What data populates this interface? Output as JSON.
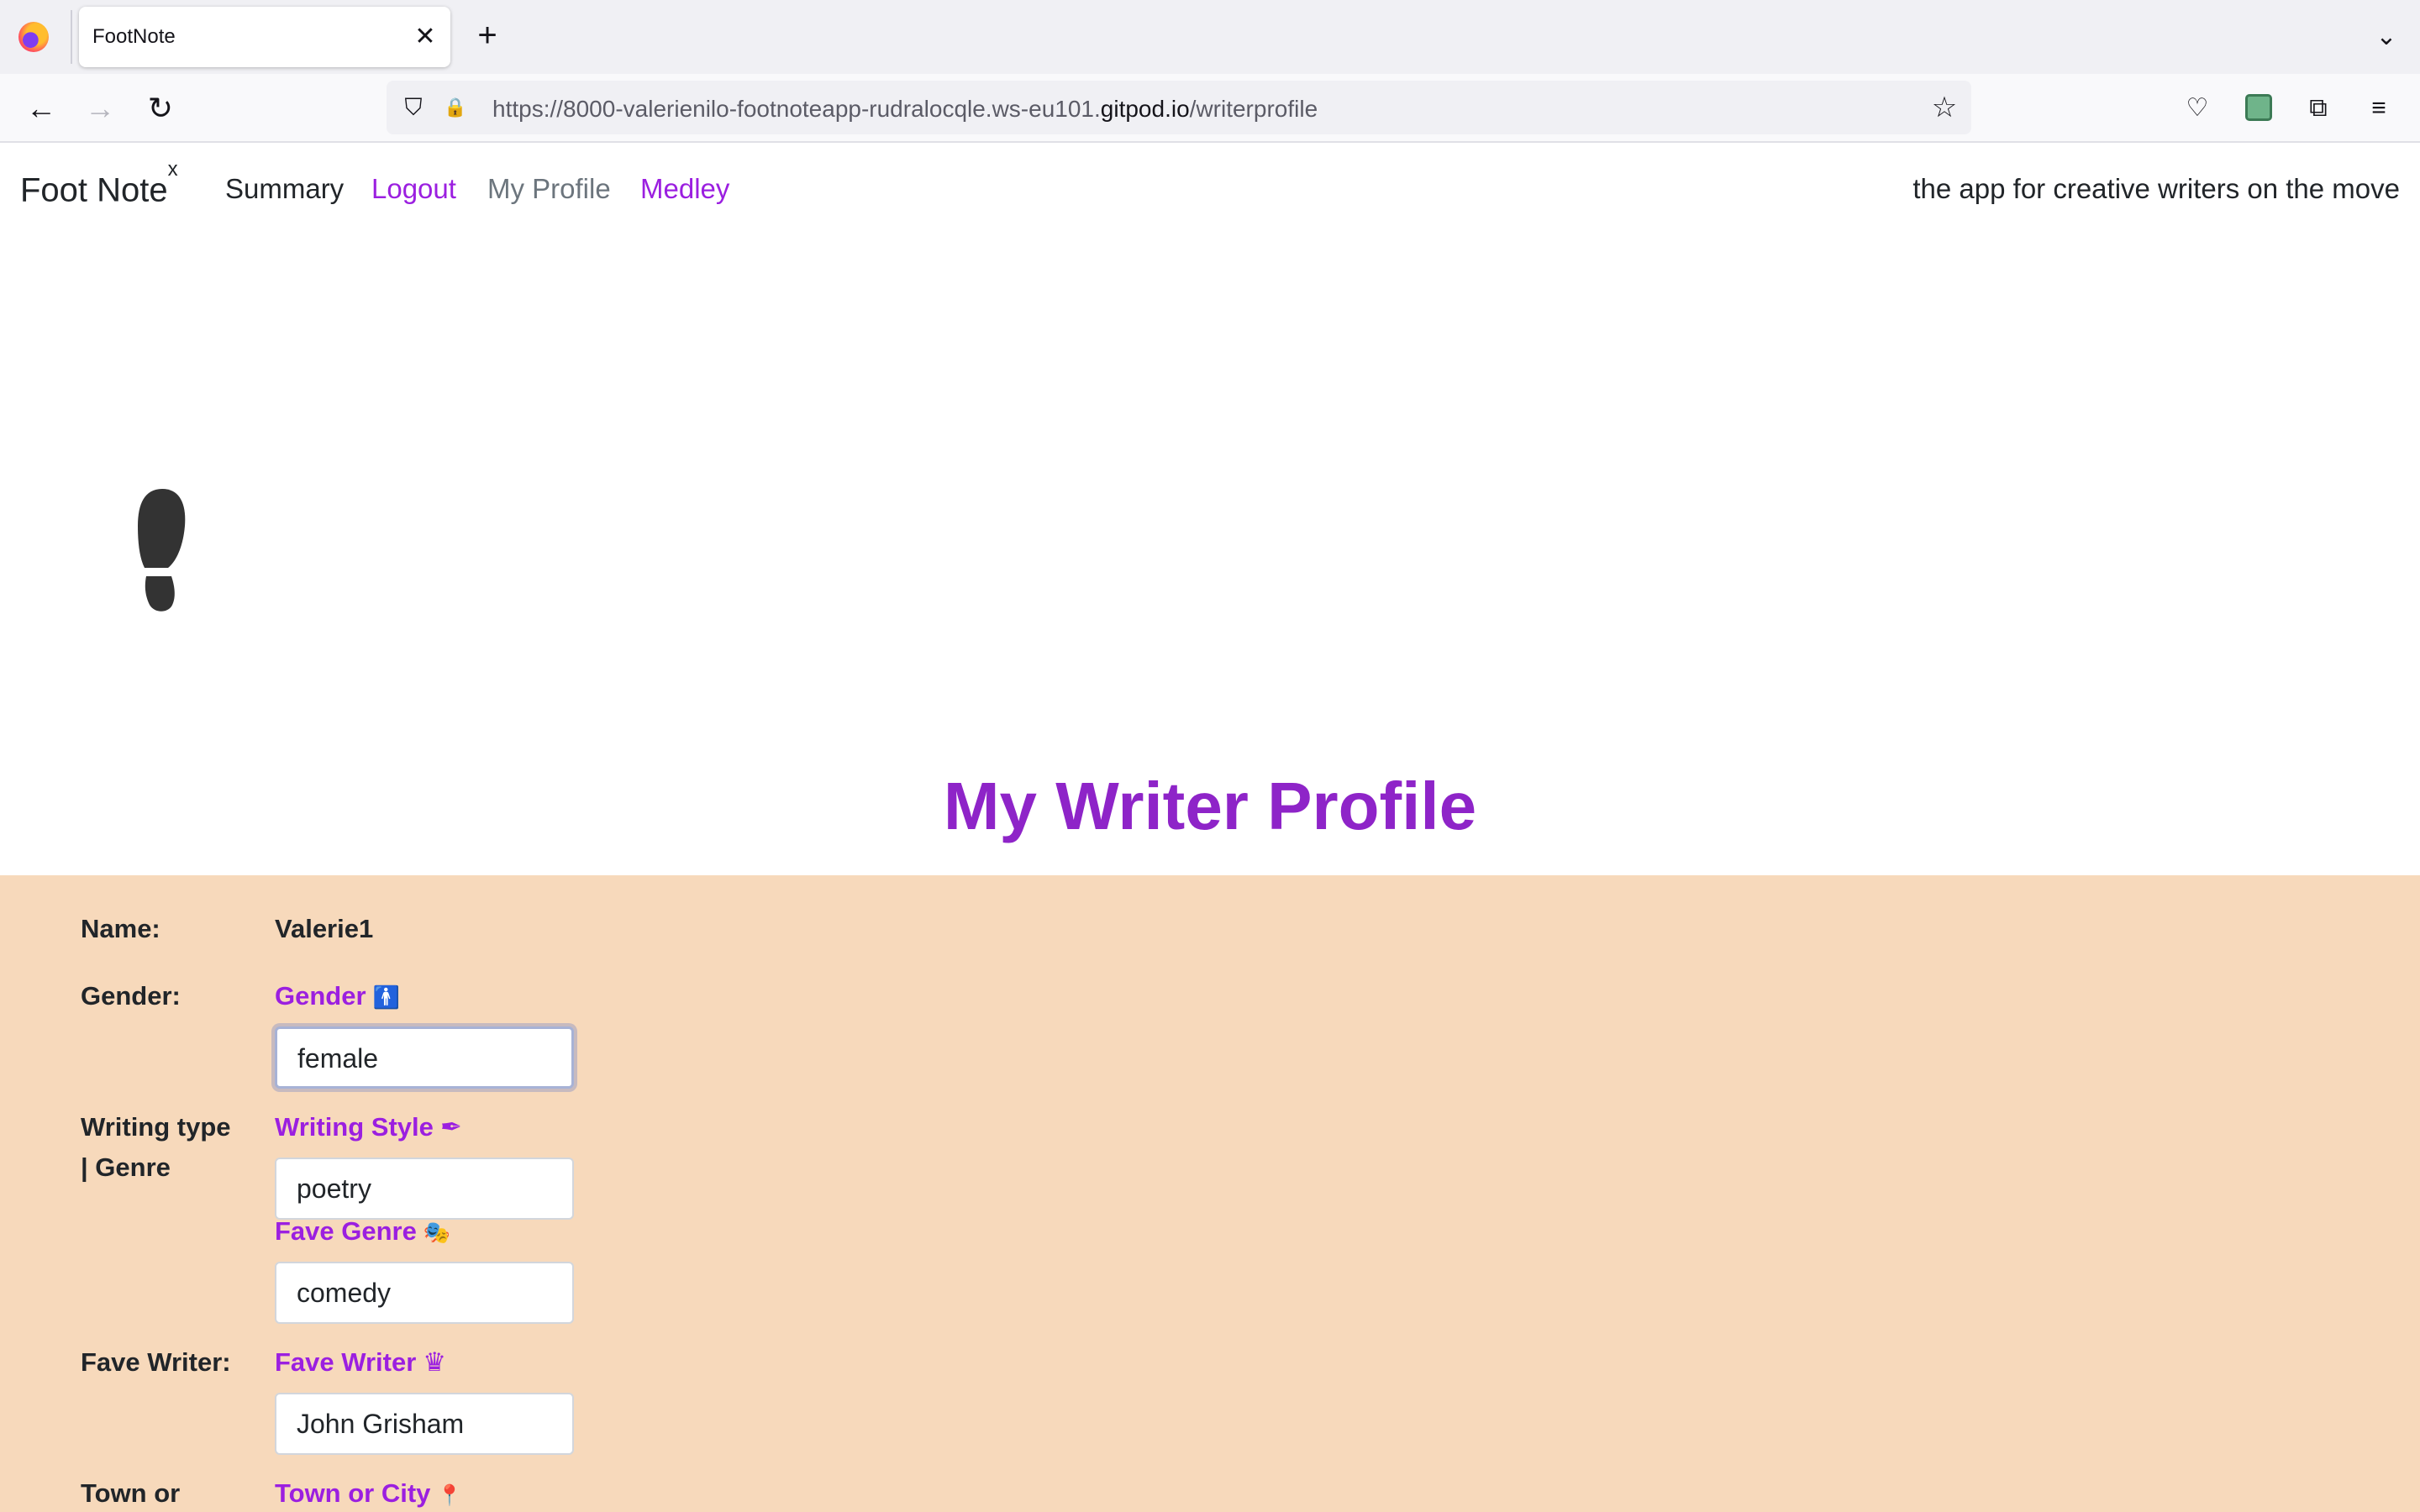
{
  "browser": {
    "tab_title": "FootNote",
    "url_prefix": "https://8000-valerienilo-footnoteapp-rudralocqle.ws-eu101.",
    "url_domain": "gitpod.io",
    "url_path": "/writerprofile",
    "tab_close_icon": "✕",
    "new_tab_icon": "+",
    "tab_list_icon": "⌄",
    "back_icon": "←",
    "forward_icon": "→",
    "reload_icon": "↻",
    "shield_icon": "⛉",
    "lock_icon": "🔒",
    "star_icon": "☆",
    "pocket_icon": "♡",
    "extensions_icon": "⧉",
    "menu_icon": "≡"
  },
  "site": {
    "brand": "Foot Note",
    "brand_sup": "x",
    "nav": {
      "summary": "Summary",
      "logout": "Logout",
      "my_profile": "My Profile",
      "medley": "Medley"
    },
    "tagline": "the app for creative writers on the move"
  },
  "profile": {
    "title": "My Writer Profile",
    "name_label": "Name:",
    "name_value": "Valerie1",
    "gender_label": "Gender:",
    "gender_field_label": "Gender",
    "gender_icon": "🚹",
    "gender_value": "female",
    "writing_label_line1": "Writing type",
    "writing_label_line2": "| Genre",
    "style_field_label": "Writing Style",
    "style_icon": "✒",
    "style_value": "poetry",
    "genre_field_label": "Fave Genre",
    "genre_icon": "🎭",
    "genre_value": "comedy",
    "writer_label": "Fave Writer:",
    "writer_field_label": "Fave Writer",
    "writer_icon": "♛",
    "writer_value": "John Grisham",
    "town_label": "Town or",
    "town_field_label": "Town or City",
    "town_icon": "📍"
  },
  "colors": {
    "accent": "#9b1fe0",
    "title": "#8e24c8",
    "panel_bg": "#f7d9bb"
  }
}
